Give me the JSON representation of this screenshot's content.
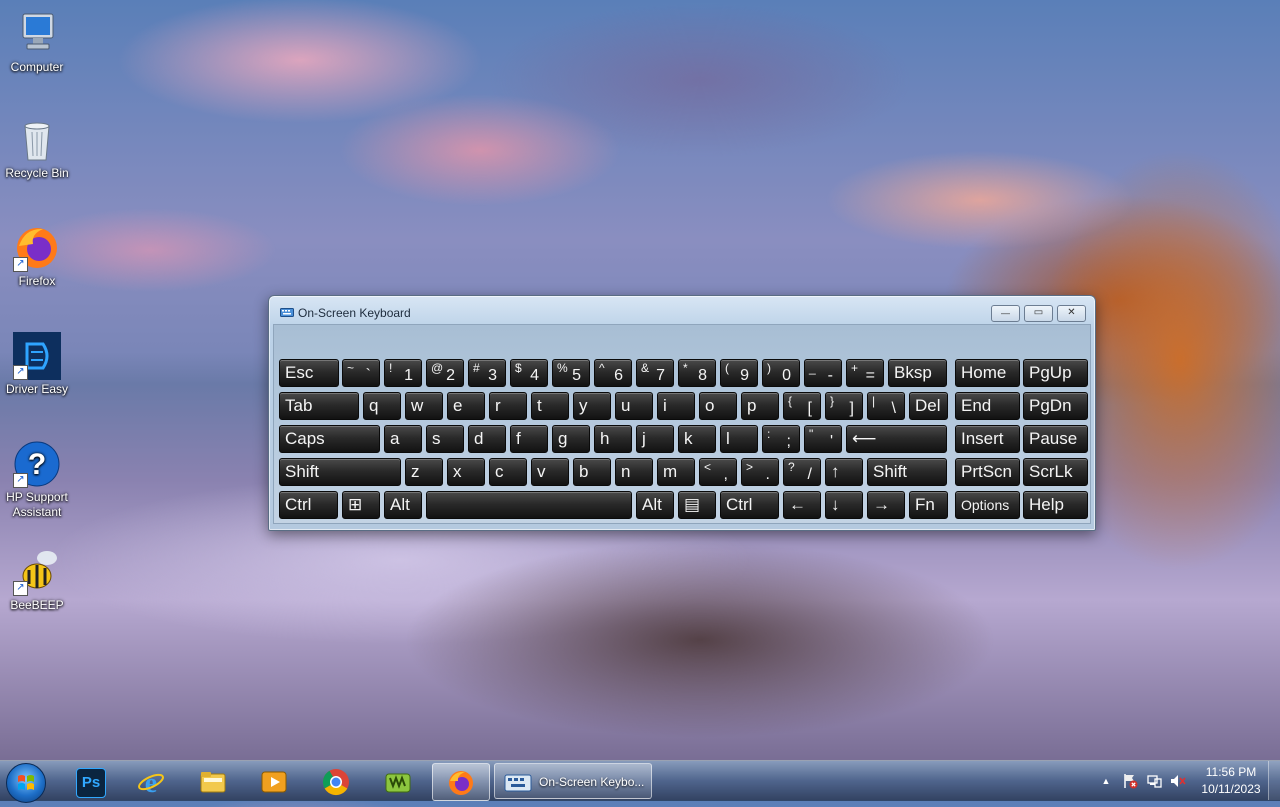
{
  "desktop": {
    "icons": [
      {
        "label": "Computer",
        "icon": "computer-icon"
      },
      {
        "label": "Recycle Bin",
        "icon": "recycle-bin-icon"
      },
      {
        "label": "Firefox",
        "icon": "firefox-icon"
      },
      {
        "label": "Driver Easy",
        "icon": "driver-easy-icon"
      },
      {
        "label": "HP Support Assistant",
        "label_line1": "HP Support",
        "label_line2": "Assistant",
        "icon": "hp-support-icon"
      },
      {
        "label": "BeeBEEP",
        "icon": "beebeep-icon"
      }
    ]
  },
  "window": {
    "title": "On-Screen Keyboard",
    "controls": {
      "minimize": "—",
      "restore": "▭",
      "close": "✕"
    }
  },
  "keyboard": {
    "row1": [
      {
        "main": "Esc"
      },
      {
        "top": "~",
        "bot": "`"
      },
      {
        "top": "!",
        "bot": "1"
      },
      {
        "top": "@",
        "bot": "2"
      },
      {
        "top": "#",
        "bot": "3"
      },
      {
        "top": "$",
        "bot": "4"
      },
      {
        "top": "%",
        "bot": "5"
      },
      {
        "top": "^",
        "bot": "6"
      },
      {
        "top": "&",
        "bot": "7"
      },
      {
        "top": "*",
        "bot": "8"
      },
      {
        "top": "(",
        "bot": "9"
      },
      {
        "top": ")",
        "bot": "0"
      },
      {
        "top": "_",
        "bot": "-"
      },
      {
        "top": "+",
        "bot": "="
      },
      {
        "main": "Bksp"
      },
      {
        "main": "Home"
      },
      {
        "main": "PgUp"
      }
    ],
    "row2": [
      {
        "main": "Tab"
      },
      {
        "main": "q"
      },
      {
        "main": "w"
      },
      {
        "main": "e"
      },
      {
        "main": "r"
      },
      {
        "main": "t"
      },
      {
        "main": "y"
      },
      {
        "main": "u"
      },
      {
        "main": "i"
      },
      {
        "main": "o"
      },
      {
        "main": "p"
      },
      {
        "top": "{",
        "bot": "["
      },
      {
        "top": "}",
        "bot": "]"
      },
      {
        "top": "|",
        "bot": "\\"
      },
      {
        "main": "Del"
      },
      {
        "main": "End"
      },
      {
        "main": "PgDn"
      }
    ],
    "row3": [
      {
        "main": "Caps"
      },
      {
        "main": "a"
      },
      {
        "main": "s"
      },
      {
        "main": "d"
      },
      {
        "main": "f"
      },
      {
        "main": "g"
      },
      {
        "main": "h"
      },
      {
        "main": "j"
      },
      {
        "main": "k"
      },
      {
        "main": "l"
      },
      {
        "top": ":",
        "bot": ";"
      },
      {
        "top": "\"",
        "bot": "'"
      },
      {
        "main": "⟵"
      },
      {
        "main": "Insert"
      },
      {
        "main": "Pause"
      }
    ],
    "row4": [
      {
        "main": "Shift"
      },
      {
        "main": "z"
      },
      {
        "main": "x"
      },
      {
        "main": "c"
      },
      {
        "main": "v"
      },
      {
        "main": "b"
      },
      {
        "main": "n"
      },
      {
        "main": "m"
      },
      {
        "top": "<",
        "bot": ","
      },
      {
        "top": ">",
        "bot": "."
      },
      {
        "top": "?",
        "bot": "/"
      },
      {
        "main": "↑"
      },
      {
        "main": "Shift"
      },
      {
        "main": "PrtScn"
      },
      {
        "main": "ScrLk"
      }
    ],
    "row5": [
      {
        "main": "Ctrl"
      },
      {
        "main": "⊞"
      },
      {
        "main": "Alt"
      },
      {
        "main": ""
      },
      {
        "main": "Alt"
      },
      {
        "main": "▤"
      },
      {
        "main": "Ctrl"
      },
      {
        "main": "←"
      },
      {
        "main": "↓"
      },
      {
        "main": "→"
      },
      {
        "main": "Fn"
      },
      {
        "main": "Options"
      },
      {
        "main": "Help"
      }
    ]
  },
  "taskbar": {
    "pinned": [
      "photoshop-icon",
      "internet-explorer-icon",
      "file-explorer-icon",
      "media-player-icon",
      "chrome-icon",
      "app-icon",
      "firefox-icon"
    ],
    "task_label": "On-Screen Keybo...",
    "tray": {
      "up_arrow": "▲"
    },
    "clock_time": "11:56 PM",
    "clock_date": "10/11/2023"
  }
}
